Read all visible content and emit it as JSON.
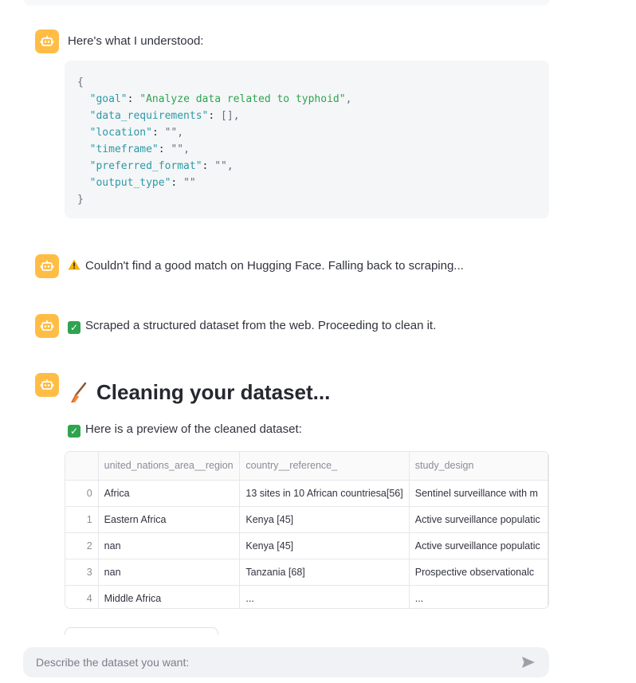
{
  "chat": {
    "understood": "Here's what I understood:",
    "code_lines": [
      {
        "type": "brace",
        "text": "{"
      },
      {
        "type": "kv",
        "key": "\"goal\"",
        "value": "\"Analyze data related to typhoid\"",
        "vclass": "s",
        "tail": ","
      },
      {
        "type": "kv",
        "key": "\"data_requirements\"",
        "value": "[]",
        "vclass": "p",
        "tail": ","
      },
      {
        "type": "kv",
        "key": "\"location\"",
        "value": "\"\"",
        "vclass": "p",
        "tail": ","
      },
      {
        "type": "kv",
        "key": "\"timeframe\"",
        "value": "\"\"",
        "vclass": "p",
        "tail": ","
      },
      {
        "type": "kv",
        "key": "\"preferred_format\"",
        "value": "\"\"",
        "vclass": "p",
        "tail": ","
      },
      {
        "type": "kv",
        "key": "\"output_type\"",
        "value": "\"\"",
        "vclass": "p",
        "tail": ""
      },
      {
        "type": "brace",
        "text": "}"
      }
    ],
    "warning_msg": "Couldn't find a good match on Hugging Face. Falling back to scraping...",
    "scraped_msg": "Scraped a structured dataset from the web. Proceeding to clean it.",
    "cleaning_heading": "Cleaning your dataset...",
    "preview_msg": "Here is a preview of the cleaned dataset:"
  },
  "table": {
    "columns": [
      "",
      "united_nations_area__region",
      "country__reference_",
      "study_design"
    ],
    "rows": [
      [
        "0",
        "Africa",
        "13 sites in 10 African countriesa[56]",
        "Sentinel surveillance with m"
      ],
      [
        "1",
        "Eastern Africa",
        "Kenya [45]",
        "Active surveillance populatic"
      ],
      [
        "2",
        "nan",
        "Kenya [45]",
        "Active surveillance populatic"
      ],
      [
        "3",
        "nan",
        "Tanzania [68]",
        "Prospective observationalc"
      ],
      [
        "4",
        "Middle Africa",
        "...",
        "..."
      ]
    ]
  },
  "input": {
    "placeholder": "Describe the dataset you want:"
  },
  "colors": {
    "avatar_bg": "#ffbd45",
    "check_green": "#2ea44f",
    "code_key": "#2b9aa6",
    "code_string": "#2ea44f"
  },
  "icons": {
    "avatar": "robot-icon",
    "warning": "warning-icon",
    "check": "check-icon",
    "broom": "broom-icon",
    "send": "send-icon"
  }
}
